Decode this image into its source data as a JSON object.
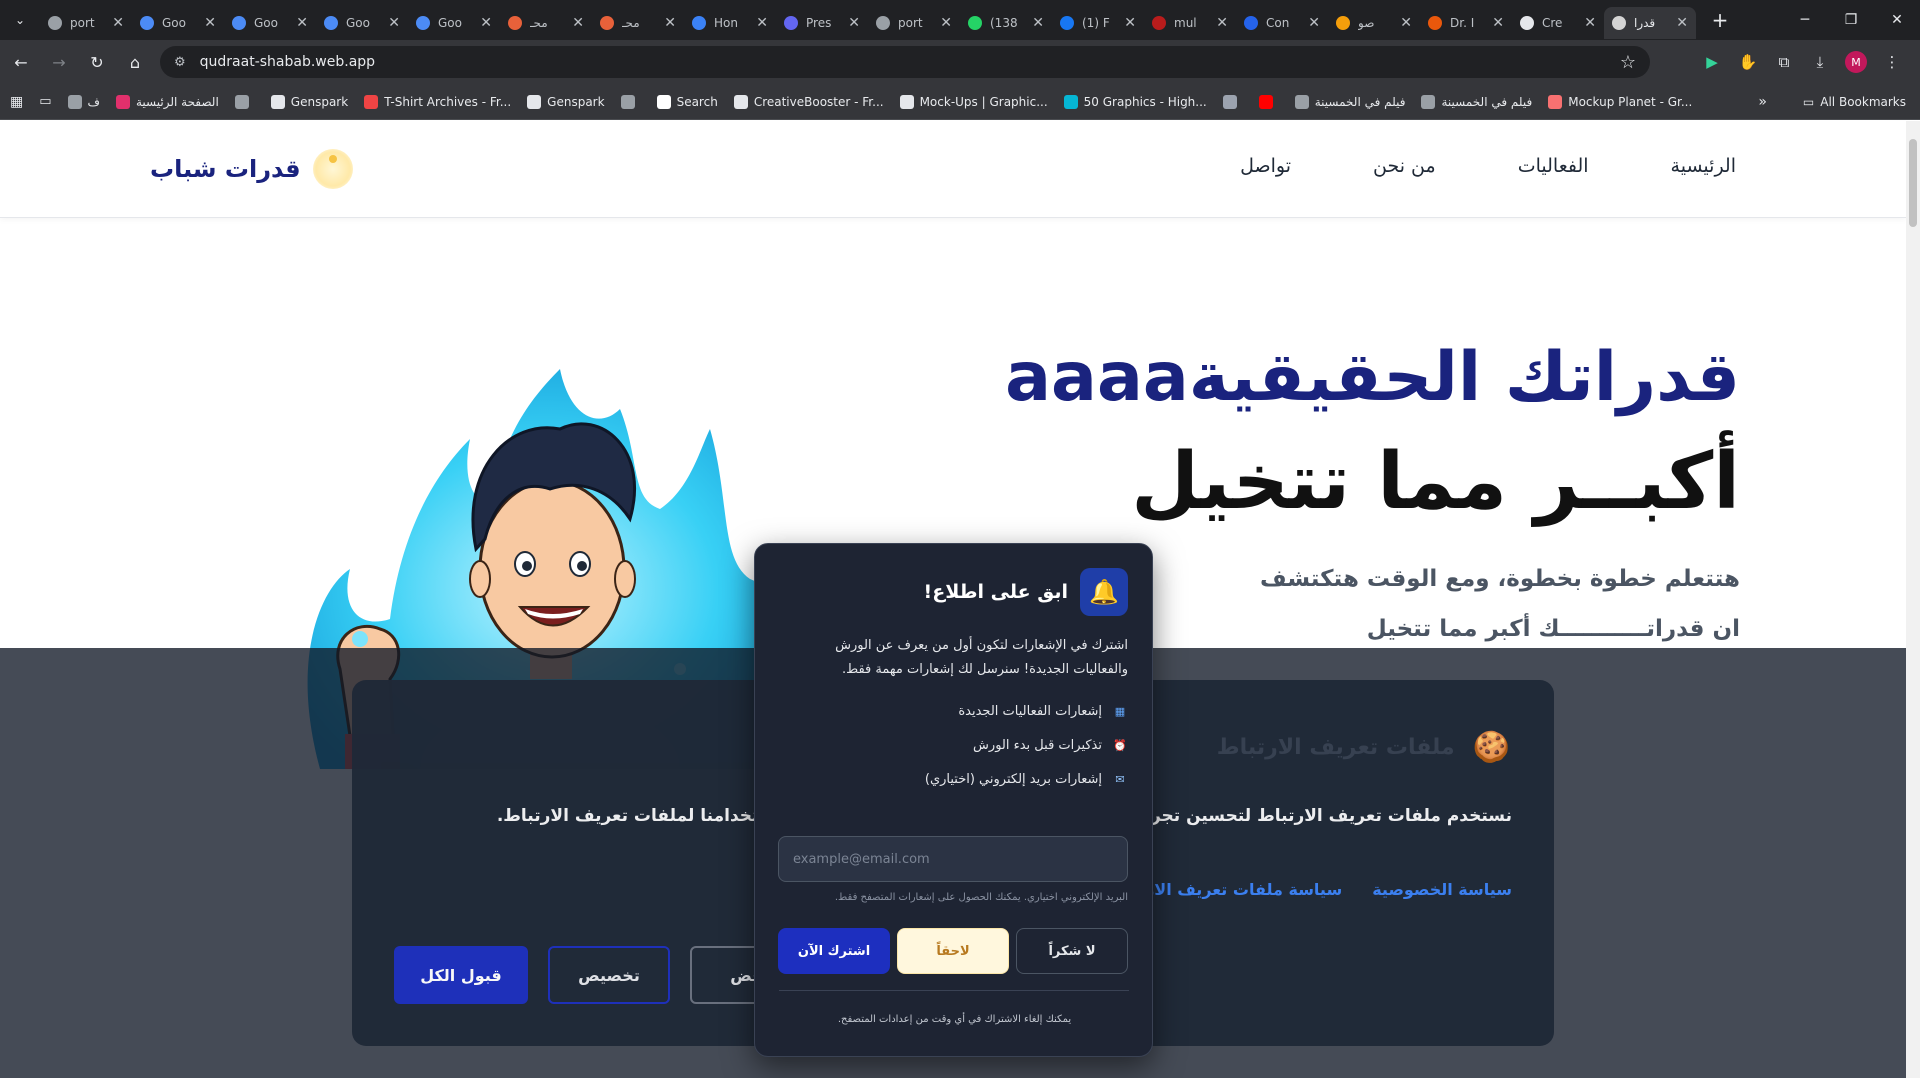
{
  "browser": {
    "tabs": [
      {
        "label": "port",
        "color": "#9aa0a6"
      },
      {
        "label": "Goo",
        "color": "#4c8bf5"
      },
      {
        "label": "Goo",
        "color": "#4c8bf5"
      },
      {
        "label": "Goo",
        "color": "#4c8bf5"
      },
      {
        "label": "Goo",
        "color": "#4c8bf5"
      },
      {
        "label": "محـ",
        "color": "#e8613a"
      },
      {
        "label": "محـ",
        "color": "#e8613a"
      },
      {
        "label": "Hon",
        "color": "#3b82f6"
      },
      {
        "label": "Pres",
        "color": "#6366f1"
      },
      {
        "label": "port",
        "color": "#9aa0a6"
      },
      {
        "label": "(138",
        "color": "#25d366"
      },
      {
        "label": "(1) F",
        "color": "#1877f2"
      },
      {
        "label": "mul",
        "color": "#b91c1c"
      },
      {
        "label": "Con",
        "color": "#2563eb"
      },
      {
        "label": "صو",
        "color": "#f59e0b"
      },
      {
        "label": "Dr. I",
        "color": "#ea580c"
      },
      {
        "label": "Cre",
        "color": "#e5e7eb"
      },
      {
        "label": "قدرا",
        "color": "#d4d4d4",
        "active": true
      }
    ],
    "url": "qudraat-shabab.web.app",
    "bookmarks": [
      {
        "label": "ف",
        "color": "#9aa0a6"
      },
      {
        "label": "الصفحة الرئيسية",
        "color": "#e1306c"
      },
      {
        "label": "",
        "color": "#9aa0a6"
      },
      {
        "label": "Genspark",
        "color": "#e5e7eb"
      },
      {
        "label": "T-Shirt Archives - Fr...",
        "color": "#ef4444"
      },
      {
        "label": "Genspark",
        "color": "#e5e7eb"
      },
      {
        "label": "",
        "color": "#9aa0a6"
      },
      {
        "label": "Search",
        "color": "#ffffff"
      },
      {
        "label": "CreativeBooster - Fr...",
        "color": "#e5e7eb"
      },
      {
        "label": "Mock-Ups | Graphic...",
        "color": "#e5e7eb"
      },
      {
        "label": "50 Graphics - High...",
        "color": "#06b6d4"
      },
      {
        "label": "",
        "color": "#9ca3af"
      },
      {
        "label": "",
        "color": "#ff0000"
      },
      {
        "label": "فيلم في الخمسينة",
        "color": "#9aa0a6"
      },
      {
        "label": "فيلم في الخمسينة",
        "color": "#9aa0a6"
      },
      {
        "label": "Mockup Planet - Gr...",
        "color": "#f87171"
      }
    ],
    "all_bookmarks": "All Bookmarks",
    "avatar_letter": "M"
  },
  "site": {
    "logo_text": "قدرات شباب",
    "nav": [
      "الرئيسية",
      "الفعاليات",
      "من نحن",
      "تواصل"
    ],
    "hero": {
      "title_line1": "قدراتك الحقيقيةaaaa",
      "title_line2": "أكبــر مما تتخيل",
      "sub_line1": "هتتعلم خطوة بخطوة، ومع الوقت هتكتشف",
      "sub_line2": "ان قدراتـــــــــــك أكبر مما تتخيل"
    }
  },
  "cookie": {
    "title": "ملفات تعريف الارتباط",
    "body": "نستخدم ملفات تعريف الارتباط لتحسين تجربتك على موقعنا. بالمتابعة، فإنك توافق على استخدامنا لملفات تعريف الارتباط.",
    "links": [
      "سياسة الخصوصية",
      "سياسة ملفات تعريف الارتباط"
    ],
    "btn_accept": "قبول الكل",
    "btn_customize": "تخصيص",
    "btn_reject": "رفض"
  },
  "notify": {
    "title": "ابق على اطلاع!",
    "desc": "اشترك في الإشعارات لتكون أول من يعرف عن الورش والفعاليات الجديدة! سنرسل لك إشعارات مهمة فقط.",
    "items": [
      {
        "label": "إشعارات الفعاليات الجديدة",
        "icon": "calendar-icon",
        "glyph": "▦",
        "color": "#60a5fa"
      },
      {
        "label": "تذكيرات قبل بدء الورش",
        "icon": "alarm-clock-icon",
        "glyph": "⏰",
        "color": "#f87171"
      },
      {
        "label": "إشعارات بريد إلكتروني (اختياري)",
        "icon": "email-icon",
        "glyph": "✉",
        "color": "#93c5fd"
      }
    ],
    "email_placeholder": "example@email.com",
    "hint": "البريد الإلكتروني اختياري. يمكنك الحصول على إشعارات المتصفح فقط.",
    "btn_no": "لا شكراً",
    "btn_later": "لاحقاً",
    "btn_subscribe": "اشترك الآن",
    "footer": "يمكنك إلغاء الاشتراك في أي وقت من إعدادات المتصفح."
  }
}
